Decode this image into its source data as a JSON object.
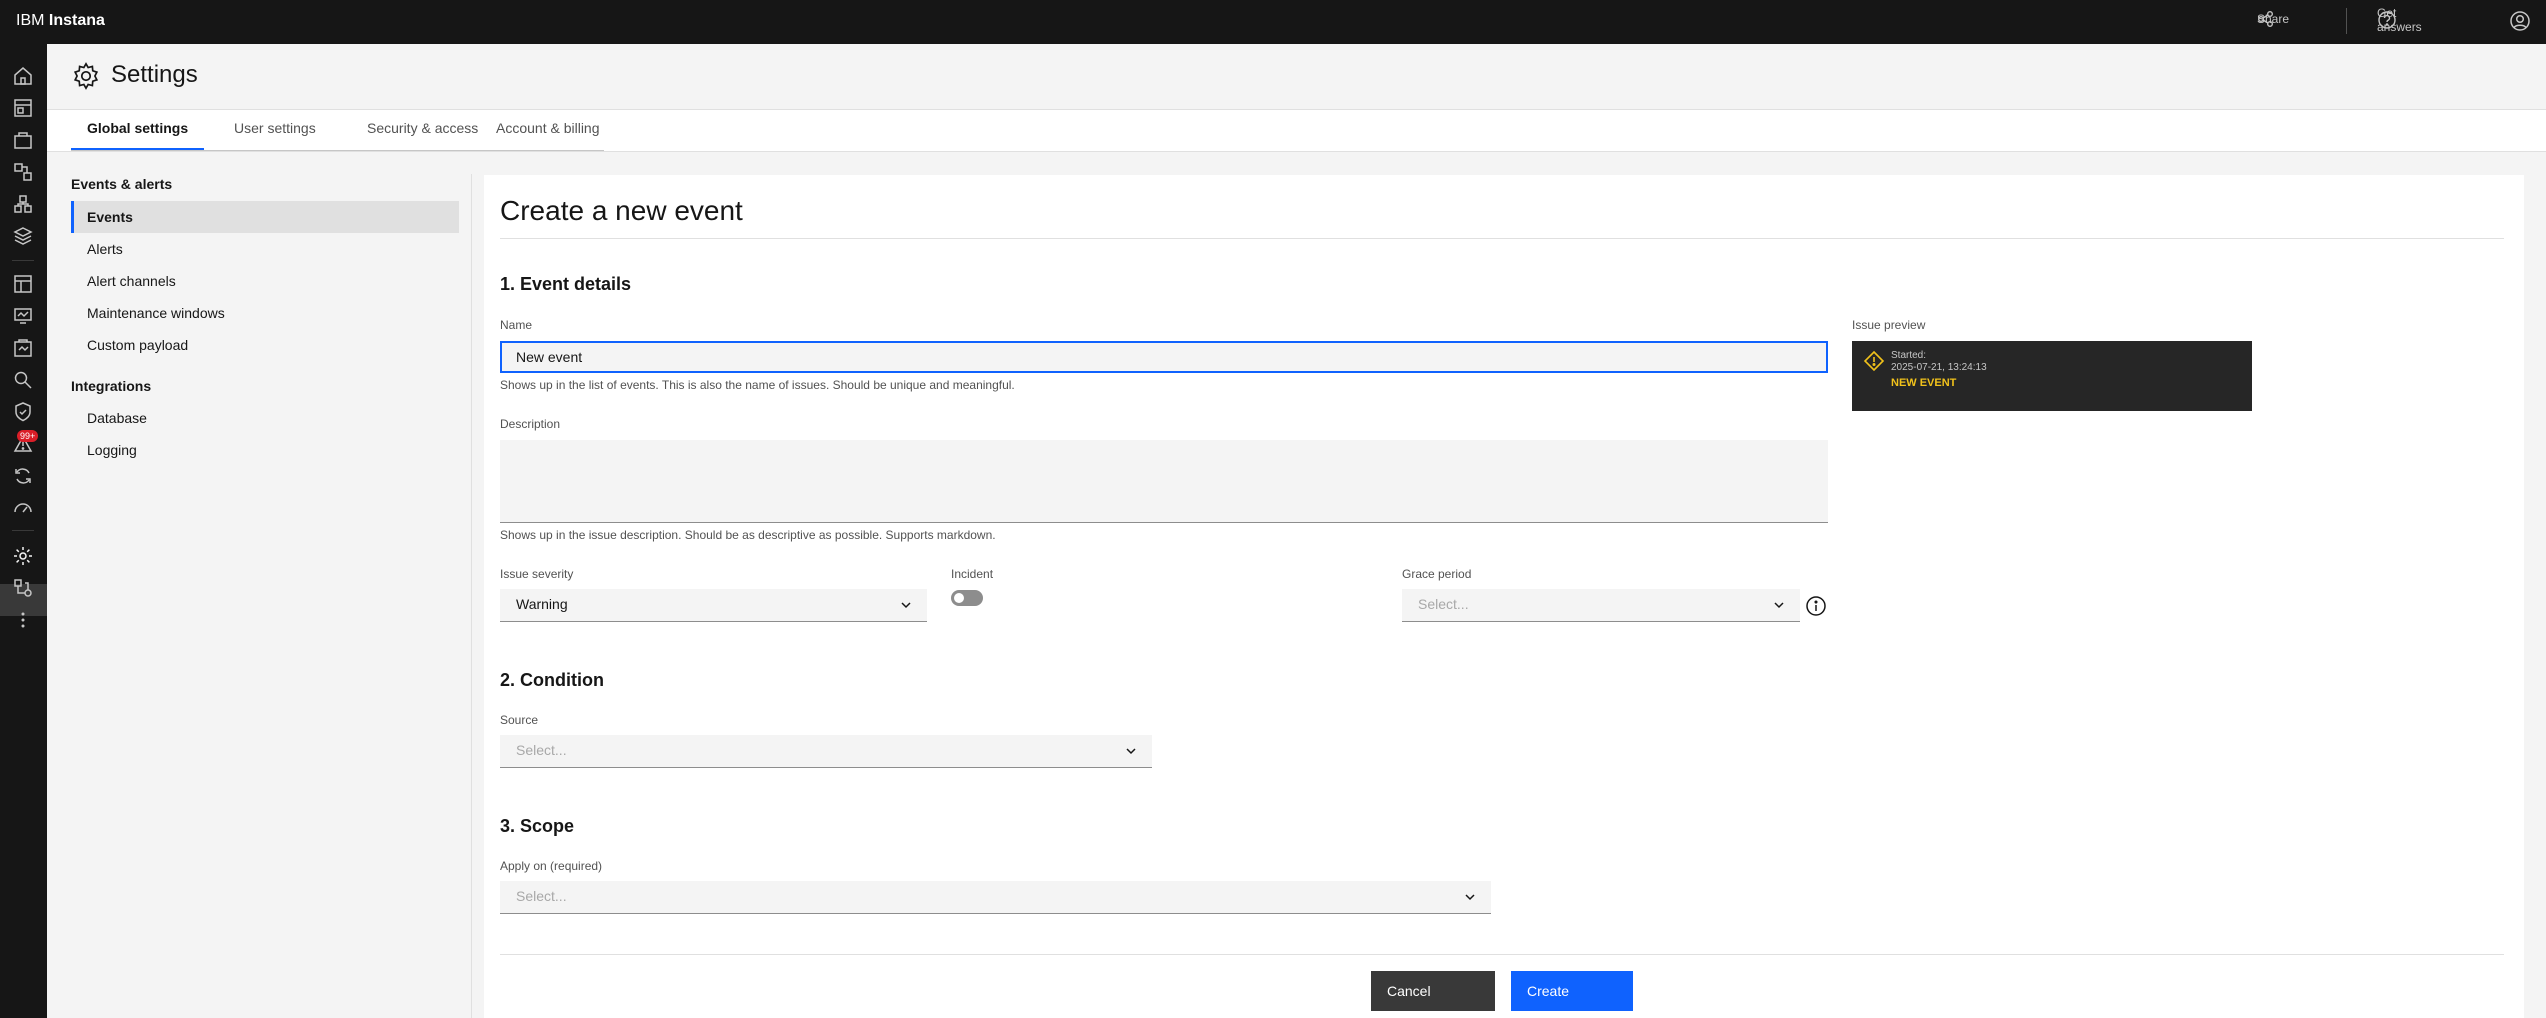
{
  "topbar": {
    "brand_ibm": "IBM",
    "brand_product": "Instana",
    "share_label": "Share",
    "get_answers_label": "Get answers"
  },
  "rail": {
    "alerts_badge": "99+"
  },
  "header": {
    "title": "Settings"
  },
  "tabs": [
    {
      "label": "Global settings",
      "active": true
    },
    {
      "label": "User settings",
      "active": false
    },
    {
      "label": "Security & access",
      "active": false
    },
    {
      "label": "Account & billing",
      "active": false
    }
  ],
  "side_nav": {
    "group1_title": "Events & alerts",
    "group1_items": [
      "Events",
      "Alerts",
      "Alert channels",
      "Maintenance windows",
      "Custom payload"
    ],
    "group2_title": "Integrations",
    "group2_items": [
      "Database",
      "Logging"
    ]
  },
  "form": {
    "title": "Create a new event",
    "section1": "1. Event details",
    "name_label": "Name",
    "name_value": "New event",
    "name_help": "Shows up in the list of events. This is also the name of issues. Should be unique and meaningful.",
    "description_label": "Description",
    "description_help": "Shows up in the issue description. Should be as descriptive as possible. Supports markdown.",
    "severity_label": "Issue severity",
    "severity_value": "Warning",
    "incident_label": "Incident",
    "incident_on": false,
    "grace_label": "Grace period",
    "grace_placeholder": "Select...",
    "section2": "2. Condition",
    "source_label": "Source",
    "source_placeholder": "Select...",
    "section3": "3. Scope",
    "apply_label": "Apply on (required)",
    "apply_placeholder": "Select...",
    "cancel_label": "Cancel",
    "create_label": "Create"
  },
  "preview": {
    "label": "Issue preview",
    "started_label": "Started:",
    "started_value": "2025-07-21, 13:24:13",
    "event_name": "NEW EVENT"
  },
  "colors": {
    "accent": "#0f62fe",
    "warning": "#f1c21b",
    "topbar": "#161616"
  }
}
